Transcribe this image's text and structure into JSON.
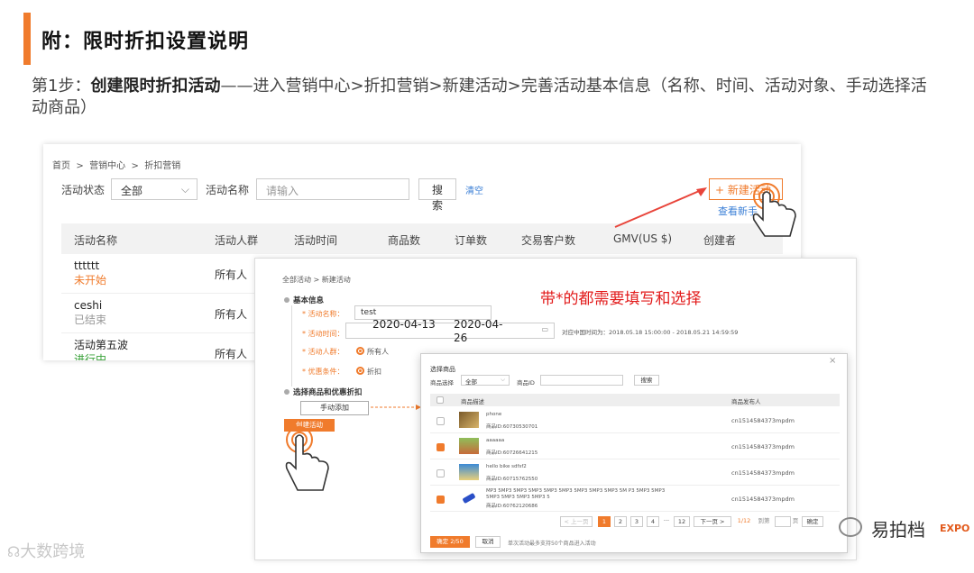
{
  "slide": {
    "title": "附：限时折扣设置说明",
    "step_prefix": "第1步：",
    "step_bold": "创建限时折扣活动",
    "step_text": "——进入营销中心>折扣营销>新建活动>完善活动基本信息（名称、时间、活动对象、手动选择活动商品）"
  },
  "list_page": {
    "breadcrumb": [
      "首页",
      ">",
      "营销中心",
      ">",
      "折扣营销"
    ],
    "filter_status_label": "活动状态",
    "filter_status_value": "全部",
    "filter_name_label": "活动名称",
    "filter_name_placeholder": "请输入",
    "search_label": "搜索",
    "clear_label": "清空",
    "new_activity_label": "+ 新建活动",
    "view_new_label": "查看新手",
    "columns": [
      "活动名称",
      "活动人群",
      "活动时间",
      "商品数",
      "订单数",
      "交易客户数",
      "GMV(US $)",
      "创建者"
    ],
    "rows": [
      {
        "name": "tttttt",
        "status": "未开始",
        "status_color": "#f07b2c",
        "audience": "所有人"
      },
      {
        "name": "ceshi",
        "status": "已结束",
        "status_color": "#999999",
        "audience": "所有人"
      },
      {
        "name": "活动第五波",
        "status": "进行中",
        "status_color": "#3aa23a",
        "audience": "所有人"
      }
    ]
  },
  "form_page": {
    "breadcrumb": "全部活动 > 新建活动",
    "section_basic": "基本信息",
    "field_name_label": "* 活动名称：",
    "field_name_value": "test",
    "field_time_label": "* 活动时间：",
    "field_time_start": "2020-04-13",
    "field_time_end": "2020-04-26",
    "time_hint": "对应中国时间为：2018.05.18 15:00:00 - 2018.05.21 14:59:59",
    "field_audience_label": "* 活动人群：",
    "field_audience_value": "所有人",
    "field_condition_label": "* 优惠条件：",
    "field_condition_value": "折扣",
    "section_goods": "选择商品和优惠折扣",
    "manual_add_label": "手动添加",
    "create_label": "创建活动",
    "annotation": "带*的都需要填写和选择"
  },
  "modal": {
    "title": "选择商品",
    "filter_label": "商品选择",
    "filter_value": "全部",
    "id_label": "商品ID",
    "search_label": "搜索",
    "col_desc": "商品描述",
    "col_publisher": "商品发布人",
    "close": "×",
    "items": [
      {
        "name": "phone",
        "id": "商品ID:60730530701",
        "publisher": "cn1514584373mpdm",
        "checked": false
      },
      {
        "name": "aaaaaa",
        "id": "商品ID:60726641215",
        "publisher": "cn1514584373mpdm",
        "checked": true
      },
      {
        "name": "hello bike sdfsf2",
        "id": "商品ID:60715762550",
        "publisher": "cn1514584373mpdm",
        "checked": false
      },
      {
        "name": "MP3 5MP3 5MP3 5MP3 5MP3 5MP3 5MP3 5MP3 5MP3 5M P3 5MP3 5MP3 5MP3 5MP3 5MP3 5MP3 5",
        "id": "商品ID:60762120686",
        "publisher": "cn1514584373mpdm",
        "checked": true
      }
    ],
    "pager": {
      "prev": "< 上一页",
      "pages": [
        "1",
        "2",
        "3",
        "4",
        "···",
        "12"
      ],
      "next": "下一页 >",
      "total": "1/12",
      "goto": "到第",
      "page_unit": "页",
      "confirm": "确定"
    },
    "ok_label": "确定 2/50",
    "cancel_label": "取消",
    "footer_hint": "单次活动最多支持50个商品进入活动"
  },
  "watermarks": {
    "left": "大数跨境",
    "right": "易拍档",
    "expo": "EXPO"
  },
  "colors": {
    "accent": "#f07b2c",
    "annotation": "#e21a1a",
    "link": "#3b7fd6"
  }
}
